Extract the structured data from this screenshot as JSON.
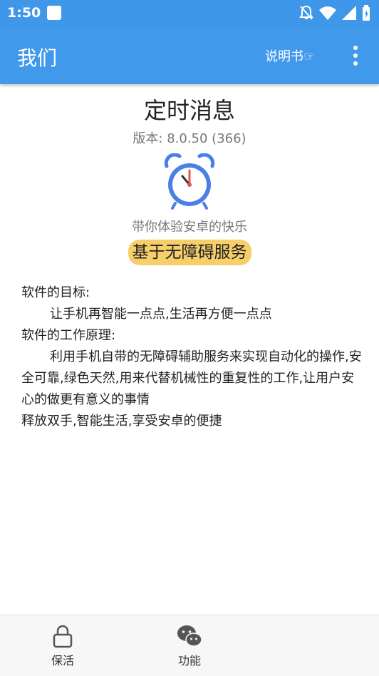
{
  "status_bar": {
    "time": "1:50",
    "icons": [
      "app-notification-icon",
      "mute-icon",
      "wifi-icon",
      "signal-icon",
      "battery-icon"
    ]
  },
  "app_bar": {
    "title": "我们",
    "manual_label": "说明书☞",
    "more_icon": "more-vert-icon"
  },
  "about": {
    "app_name": "定时消息",
    "version": "版本: 8.0.50 (366)",
    "icon": "alarm-clock-icon",
    "tagline": "带你体验安卓的快乐",
    "badge": "基于无障碍服务",
    "description": [
      "软件的目标:",
      "让手机再智能一点点,生活再方便一点点",
      "软件的工作原理:",
      "利用手机自带的无障碍辅助服务来实现自动化的操作,安全可靠,绿色天然,用来代替机械性的重复性的工作,让用户安心的做更有意义的事情",
      "释放双手,智能生活,享受安卓的便捷"
    ]
  },
  "bottom_nav": {
    "items": [
      {
        "label": "保活",
        "icon": "lock-icon"
      },
      {
        "label": "功能",
        "icon": "wechat-icon"
      }
    ]
  },
  "colors": {
    "primary": "#4199eb",
    "badge": "#f6cf6a",
    "clock_blue": "#4a7fe6",
    "clock_red": "#e05555"
  }
}
